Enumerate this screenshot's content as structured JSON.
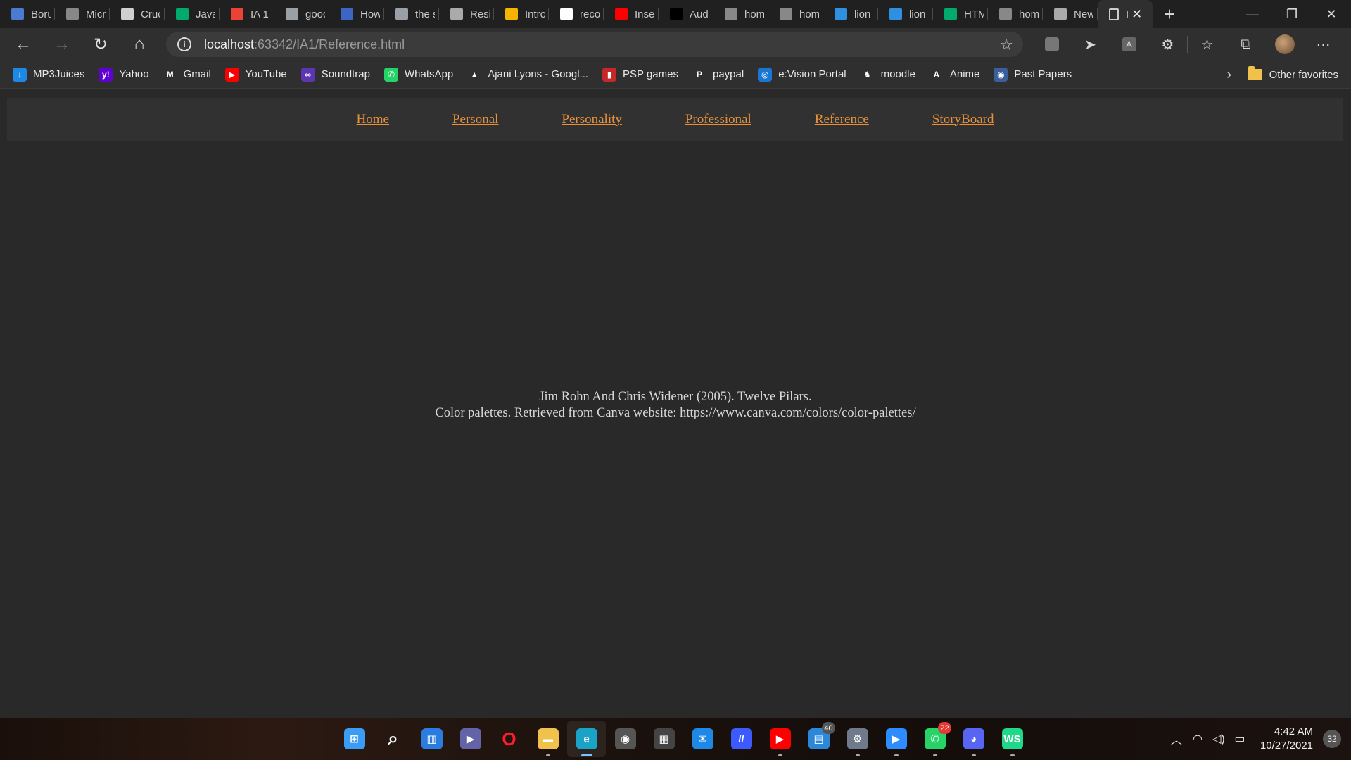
{
  "browser": {
    "tabs": [
      {
        "icon": "bookmark-a-icon",
        "title": "Boru",
        "color": "#4a7bd0"
      },
      {
        "icon": "page-icon",
        "title": "Micr",
        "color": "#888888"
      },
      {
        "icon": "amazon-icon",
        "title": "Cruc",
        "color": "#d0d0d0"
      },
      {
        "icon": "w3schools-icon",
        "title": "Java",
        "color": "#04aa6d"
      },
      {
        "icon": "gmail-icon",
        "title": "IA 1",
        "color": "#ea4335"
      },
      {
        "icon": "google-icon",
        "title": "gooc",
        "color": "#9aa0a6"
      },
      {
        "icon": "info-icon",
        "title": "How",
        "color": "#3b66c4"
      },
      {
        "icon": "google-icon",
        "title": "the s",
        "color": "#9aa0a6"
      },
      {
        "icon": "resize-icon",
        "title": "Resiz",
        "color": "#aaaaaa"
      },
      {
        "icon": "slides-icon",
        "title": "Intro",
        "color": "#f4b400"
      },
      {
        "icon": "google-icon",
        "title": "recor",
        "color": "#ffffff"
      },
      {
        "icon": "youtube-icon",
        "title": "Inser",
        "color": "#ff0000"
      },
      {
        "icon": "jetbrains-icon",
        "title": "Audi",
        "color": "#000000"
      },
      {
        "icon": "page-icon",
        "title": "hom",
        "color": "#888888"
      },
      {
        "icon": "page-icon",
        "title": "hom",
        "color": "#888888"
      },
      {
        "icon": "bing-icon",
        "title": "lion",
        "color": "#2f8fe0"
      },
      {
        "icon": "bing-icon",
        "title": "lion",
        "color": "#2f8fe0"
      },
      {
        "icon": "w3schools-icon",
        "title": "HTM",
        "color": "#04aa6d"
      },
      {
        "icon": "page-icon",
        "title": "hom",
        "color": "#888888"
      },
      {
        "icon": "newtab-icon",
        "title": "New",
        "color": "#aaaaaa"
      }
    ],
    "active_tab": {
      "icon": "page-icon",
      "title": "I"
    },
    "address": {
      "host": "localhost",
      "path": ":63342/IA1/Reference.html"
    },
    "favorites": [
      {
        "icon": "download-icon",
        "label": "MP3Juices",
        "color": "#1e88e5",
        "glyph": "↓"
      },
      {
        "icon": "yahoo-icon",
        "label": "Yahoo",
        "color": "#6001d2",
        "glyph": "y!"
      },
      {
        "icon": "gmail-icon",
        "label": "Gmail",
        "color": "#2f2f2f",
        "glyph": "M"
      },
      {
        "icon": "youtube-icon",
        "label": "YouTube",
        "color": "#ff0000",
        "glyph": "▶"
      },
      {
        "icon": "soundtrap-icon",
        "label": "Soundtrap",
        "color": "#5e35b1",
        "glyph": "∞"
      },
      {
        "icon": "whatsapp-icon",
        "label": "WhatsApp",
        "color": "#25d366",
        "glyph": "✆"
      },
      {
        "icon": "drive-icon",
        "label": "Ajani Lyons - Googl...",
        "color": "#2f2f2f",
        "glyph": "▲"
      },
      {
        "icon": "psp-icon",
        "label": "PSP games",
        "color": "#c62828",
        "glyph": "▮"
      },
      {
        "icon": "paypal-icon",
        "label": "paypal",
        "color": "#2f2f2f",
        "glyph": "P"
      },
      {
        "icon": "evision-icon",
        "label": "e:Vision Portal",
        "color": "#1976d2",
        "glyph": "◎"
      },
      {
        "icon": "moodle-icon",
        "label": "moodle",
        "color": "#2f2f2f",
        "glyph": "♞"
      },
      {
        "icon": "anime-icon",
        "label": "Anime",
        "color": "#2f2f2f",
        "glyph": "A"
      },
      {
        "icon": "past-papers-icon",
        "label": "Past Papers",
        "color": "#3a5f9a",
        "glyph": "◉"
      }
    ],
    "other_favorites": "Other favorites"
  },
  "page": {
    "nav": [
      "Home",
      "Personal",
      "Personality",
      "Professional",
      "Reference",
      "StoryBoard"
    ],
    "references": [
      "Jim Rohn And Chris Widener (2005). Twelve Pilars.",
      "Color palettes. Retrieved from Canva website: https://www.canva.com/colors/color-palettes/"
    ],
    "link_color": "#e8913c"
  },
  "taskbar": {
    "apps": [
      {
        "name": "start-icon",
        "color": "#3b9cf5",
        "glyph": "⊞",
        "running": false
      },
      {
        "name": "search-icon",
        "color": "transparent",
        "glyph": "⌕",
        "running": false
      },
      {
        "name": "widgets-icon",
        "color": "#2a7ddf",
        "glyph": "▥",
        "running": false
      },
      {
        "name": "teams-chat-icon",
        "color": "#6264a7",
        "glyph": "▶",
        "running": false
      },
      {
        "name": "opera-icon",
        "color": "transparent",
        "glyph": "O",
        "running": false
      },
      {
        "name": "file-explorer-icon",
        "color": "#f0c24b",
        "glyph": "▬",
        "running": true
      },
      {
        "name": "edge-icon",
        "color": "#1aa3c7",
        "glyph": "e",
        "running": true
      },
      {
        "name": "media-player-icon",
        "color": "#555555",
        "glyph": "◉",
        "running": false
      },
      {
        "name": "store-icon",
        "color": "#444444",
        "glyph": "▦",
        "running": false
      },
      {
        "name": "mail-icon",
        "color": "#1e88e5",
        "glyph": "✉",
        "running": false
      },
      {
        "name": "jetbrains-toolbox-icon",
        "color": "#3d5afe",
        "glyph": "//",
        "running": false
      },
      {
        "name": "youtube-music-icon",
        "color": "#ff0000",
        "glyph": "▶",
        "running": true
      },
      {
        "name": "notepad-icon",
        "color": "#2b88d8",
        "glyph": "▤",
        "running": false,
        "badge": "40",
        "badge_color": "#555555"
      },
      {
        "name": "settings-icon",
        "color": "#6f7b8a",
        "glyph": "⚙",
        "running": true
      },
      {
        "name": "zoom-icon",
        "color": "#2d8cff",
        "glyph": "▶",
        "running": true
      },
      {
        "name": "whatsapp-icon",
        "color": "#25d366",
        "glyph": "✆",
        "running": true,
        "badge": "22",
        "badge_color": "#e53935"
      },
      {
        "name": "discord-icon",
        "color": "#5865f2",
        "glyph": "◕",
        "running": true
      },
      {
        "name": "webstorm-icon",
        "color": "#21d789",
        "glyph": "WS",
        "running": true
      }
    ],
    "time": "4:42 AM",
    "date": "10/27/2021",
    "notification_count": "32"
  }
}
